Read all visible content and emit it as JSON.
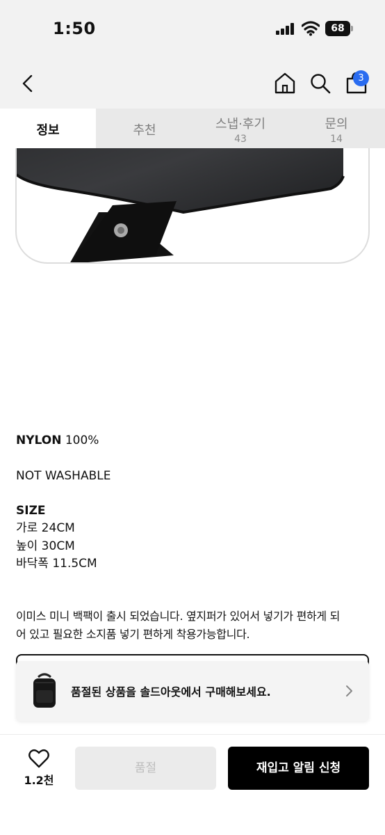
{
  "status_bar": {
    "time": "1:50",
    "battery": "68"
  },
  "header": {
    "cart_count": "3"
  },
  "tabs": [
    {
      "label": "정보",
      "count": ""
    },
    {
      "label": "추천",
      "count": ""
    },
    {
      "label": "스냅·후기",
      "count": "43"
    },
    {
      "label": "문의",
      "count": "14"
    }
  ],
  "details": {
    "material_label": "NYLON",
    "material_value": " 100%",
    "wash": "NOT WASHABLE",
    "size_title": "SIZE",
    "size_width": "가로 24CM",
    "size_height": "높이 30CM",
    "size_depth": "바닥폭 11.5CM",
    "description_line1": "이미스 미니 백팩이 출시 되었습니다. 옆지퍼가 있어서 넣기가 편하게 되",
    "description_line2": "어 있고 필요한 소지품 넣기 편하게 착용가능합니다."
  },
  "soldout_banner": {
    "message": "품절된 상품을 솔드아웃에서 구매해보세요."
  },
  "bottom_bar": {
    "like_count": "1.2천",
    "soldout_label": "품절",
    "restock_label": "재입고 알림 신청"
  }
}
